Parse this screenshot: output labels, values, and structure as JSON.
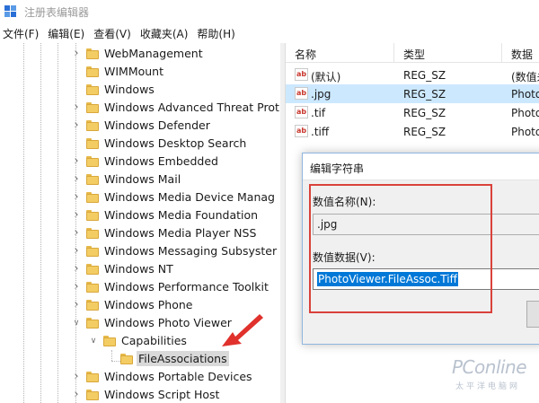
{
  "window": {
    "title": "注册表编辑器"
  },
  "menu": [
    "文件(F)",
    "编辑(E)",
    "查看(V)",
    "收藏夹(A)",
    "帮助(H)"
  ],
  "tree": {
    "items": [
      {
        "label": "WebManagement",
        "expander": "collapsed"
      },
      {
        "label": "WIMMount",
        "expander": "none"
      },
      {
        "label": "Windows",
        "expander": "none"
      },
      {
        "label": "Windows Advanced Threat Prot",
        "expander": "collapsed"
      },
      {
        "label": "Windows Defender",
        "expander": "collapsed"
      },
      {
        "label": "Windows Desktop Search",
        "expander": "none"
      },
      {
        "label": "Windows Embedded",
        "expander": "collapsed"
      },
      {
        "label": "Windows Mail",
        "expander": "collapsed"
      },
      {
        "label": "Windows Media Device Manag",
        "expander": "collapsed"
      },
      {
        "label": "Windows Media Foundation",
        "expander": "collapsed"
      },
      {
        "label": "Windows Media Player NSS",
        "expander": "collapsed"
      },
      {
        "label": "Windows Messaging Subsyster",
        "expander": "collapsed"
      },
      {
        "label": "Windows NT",
        "expander": "collapsed"
      },
      {
        "label": "Windows Performance Toolkit",
        "expander": "collapsed"
      },
      {
        "label": "Windows Phone",
        "expander": "collapsed"
      },
      {
        "label": "Windows Photo Viewer",
        "expander": "expanded"
      },
      {
        "label": "Capabilities",
        "expander": "expanded"
      },
      {
        "label": "FileAssociations",
        "expander": "none",
        "selected": true
      },
      {
        "label": "Windows Portable Devices",
        "expander": "collapsed"
      },
      {
        "label": "Windows Script Host",
        "expander": "collapsed"
      }
    ]
  },
  "list": {
    "columns": [
      "名称",
      "类型",
      "数据"
    ],
    "rows": [
      {
        "name": "(默认)",
        "type": "REG_SZ",
        "data": "(数值未"
      },
      {
        "name": ".jpg",
        "type": "REG_SZ",
        "data": "Photo",
        "selected": true
      },
      {
        "name": ".tif",
        "type": "REG_SZ",
        "data": "Photo"
      },
      {
        "name": ".tiff",
        "type": "REG_SZ",
        "data": "Photo"
      }
    ]
  },
  "dialog": {
    "title": "编辑字符串",
    "name_label": "数值名称(N):",
    "name_value": ".jpg",
    "data_label": "数值数据(V):",
    "data_value": "PhotoViewer.FileAssoc.Tiff"
  },
  "icons": {
    "folder": "folder-icon",
    "string_value": "ab-string-icon",
    "app": "regedit-icon",
    "arrow": "red-arrow-annotation"
  },
  "watermark": {
    "brand": "PConline",
    "sub": "太平洋电脑网"
  },
  "colors": {
    "selection": "#cce8ff",
    "highlight": "#0078d7",
    "annotation": "#d9423a",
    "folder": "#f3cd63"
  }
}
